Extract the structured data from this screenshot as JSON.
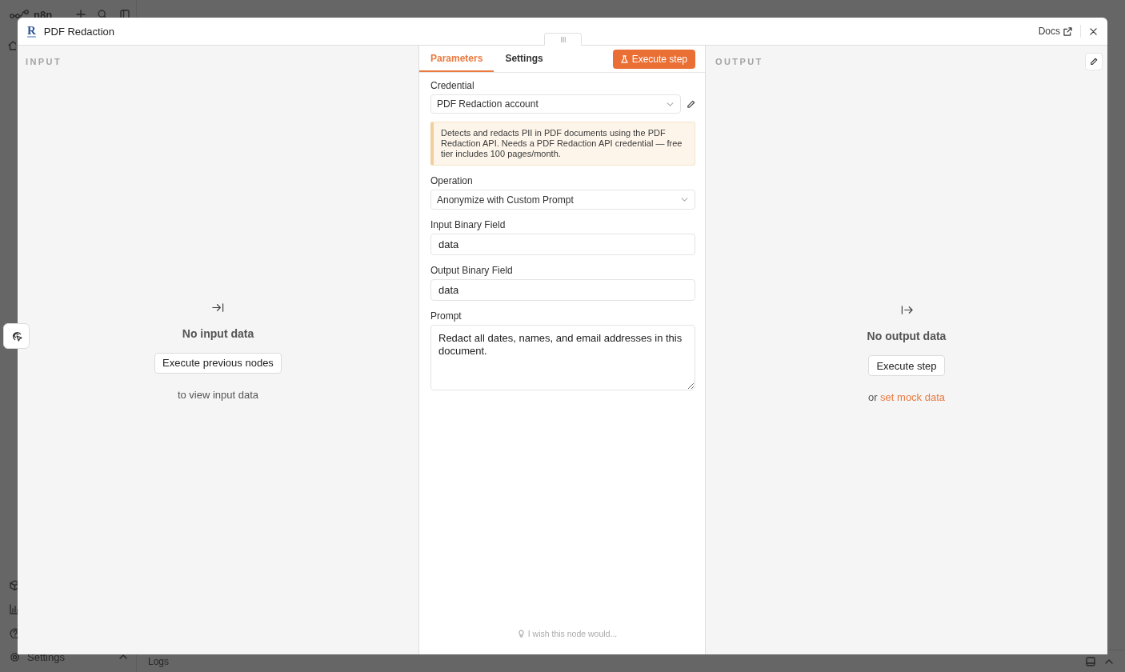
{
  "background_app": {
    "logo": "n8n",
    "sidebar_settings": "Settings",
    "logs_tab": "Logs"
  },
  "window": {
    "logo_letter": "R",
    "title": "PDF Redaction",
    "docs_link": "Docs"
  },
  "input_panel": {
    "heading": "INPUT",
    "empty_title": "No input data",
    "button": "Execute previous nodes",
    "hint": "to view input data"
  },
  "parameters_panel": {
    "tabs": [
      {
        "label": "Parameters",
        "selected": true
      },
      {
        "label": "Settings",
        "selected": false
      }
    ],
    "execute_button": "Execute step",
    "fields": [
      {
        "kind": "credential",
        "label": "Credential",
        "value": "PDF Redaction account"
      },
      {
        "kind": "notice",
        "text": "Detects and redacts PII in PDF documents using the PDF Redaction API. Needs a PDF Redaction API credential — free tier includes 100 pages/month."
      },
      {
        "kind": "select",
        "label": "Operation",
        "value": "Anonymize with Custom Prompt"
      },
      {
        "kind": "input",
        "label": "Input Binary Field",
        "value": "data"
      },
      {
        "kind": "input",
        "label": "Output Binary Field",
        "value": "data"
      },
      {
        "kind": "textarea",
        "label": "Prompt",
        "value": "Redact all dates, names, and email addresses in this document."
      }
    ],
    "feedback": "I wish this node would..."
  },
  "output_panel": {
    "heading": "OUTPUT",
    "empty_title": "No output data",
    "button": "Execute step",
    "hint": "or",
    "hint_link": "set mock data"
  }
}
